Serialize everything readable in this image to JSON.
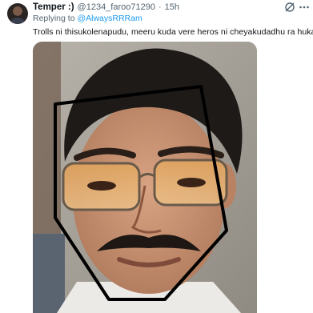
{
  "tweet": {
    "display_name": "Temper :)",
    "handle": "@1234_faroo71290",
    "separator": "·",
    "time": "15h",
    "reply_prefix": "Replying to",
    "reply_mention": "@AlwaysRRRam",
    "text": "Trolls ni thisukolenapudu, meeru kuda vere heros ni  cheyakudadhu ra huka"
  },
  "icons": {
    "avatar": "profile-avatar",
    "grok": "grok-slash-icon",
    "more": "more-dots-icon"
  },
  "colors": {
    "link": "#1d9bf0",
    "secondary_text": "#536471",
    "primary_text": "#0f1419"
  }
}
